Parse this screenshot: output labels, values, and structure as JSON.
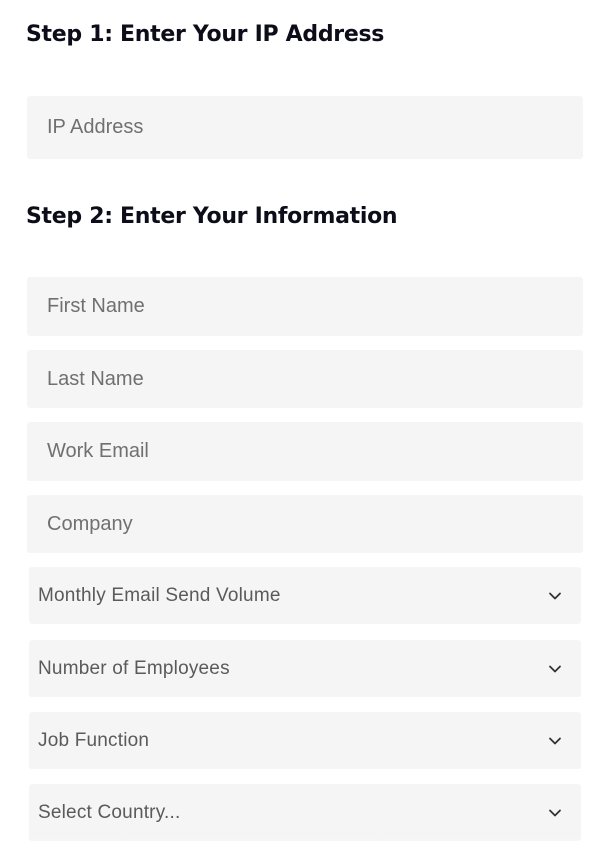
{
  "step1": {
    "heading": "Step 1: Enter Your IP Address",
    "ip_field": {
      "placeholder": "IP Address",
      "value": ""
    }
  },
  "step2": {
    "heading": "Step 2: Enter Your Information",
    "fields": [
      {
        "placeholder": "First Name",
        "value": ""
      },
      {
        "placeholder": "Last Name",
        "value": ""
      },
      {
        "placeholder": "Work Email",
        "value": ""
      },
      {
        "placeholder": "Company",
        "value": ""
      }
    ],
    "selects": [
      {
        "label": "Monthly Email Send Volume",
        "icon": "chevron-down-icon"
      },
      {
        "label": "Number of Employees",
        "icon": "chevron-down-icon"
      },
      {
        "label": "Job Function",
        "icon": "chevron-down-icon"
      },
      {
        "label": "Select Country...",
        "icon": "chevron-down-icon"
      }
    ]
  },
  "colors": {
    "heading": "#0d0d1a",
    "field_background": "#f5f5f5",
    "placeholder": "#707070",
    "select_text": "#5a5a5a"
  }
}
